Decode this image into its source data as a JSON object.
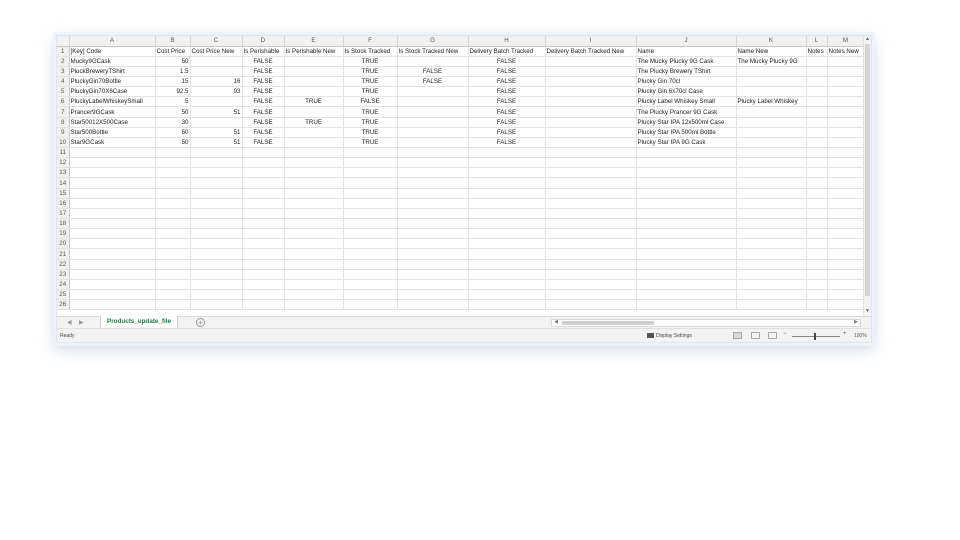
{
  "columns": [
    "A",
    "B",
    "C",
    "D",
    "E",
    "F",
    "G",
    "H",
    "I",
    "J",
    "K",
    "L",
    "M"
  ],
  "headers": [
    "[Key] Code",
    "Cost Price",
    "Cost Price New",
    "Is Perishable",
    "Is Perishable New",
    "Is Stock Tracked",
    "Is Stock Tracked New",
    "Delivery Batch Tracked",
    "Delivery Batch Tracked New",
    "Name",
    "Name New",
    "Notes",
    "Notes New"
  ],
  "rows": [
    [
      "Mucky9GCask",
      "50",
      "",
      "FALSE",
      "",
      "TRUE",
      "",
      "FALSE",
      "",
      "The Mucky Plucky 9G Cask",
      "The Mucky Plucky 9G",
      "",
      ""
    ],
    [
      "PluckBreweryTShirt",
      "1.5",
      "",
      "FALSE",
      "",
      "TRUE",
      "FALSE",
      "FALSE",
      "",
      "The Plucky Brewery TShirt",
      "",
      "",
      ""
    ],
    [
      "PluckyGin70Bottle",
      "15",
      "16",
      "FALSE",
      "",
      "TRUE",
      "FALSE",
      "FALSE",
      "",
      "Plucky Gin 70cl",
      "",
      "",
      ""
    ],
    [
      "PluckyGin70X6Case",
      "92.5",
      "93",
      "FALSE",
      "",
      "TRUE",
      "",
      "FALSE",
      "",
      "Plucky Gin 6x70cl Case",
      "",
      "",
      ""
    ],
    [
      "PluckyLabelWhiskeySmall",
      "5",
      "",
      "FALSE",
      "TRUE",
      "FALSE",
      "",
      "FALSE",
      "",
      "Plucky Label Whiskey Small",
      "Plucky Label Whiskey",
      "",
      ""
    ],
    [
      "Prancer9GCask",
      "50",
      "51",
      "FALSE",
      "",
      "TRUE",
      "",
      "FALSE",
      "",
      "The Plucky Prancer 9G Cask",
      "",
      "",
      ""
    ],
    [
      "Star50012X500Case",
      "30",
      "",
      "FALSE",
      "TRUE",
      "TRUE",
      "",
      "FALSE",
      "",
      "Plucky Star IPA 12x500ml Case",
      "",
      "",
      ""
    ],
    [
      "Star500Bottle",
      "50",
      "51",
      "FALSE",
      "",
      "TRUE",
      "",
      "FALSE",
      "",
      "Plucky Star IPA 500ml Bottle",
      "",
      "",
      ""
    ],
    [
      "Star9GCask",
      "50",
      "51",
      "FALSE",
      "",
      "TRUE",
      "",
      "FALSE",
      "",
      "Plucky Star IPA 9G Cask",
      "",
      "",
      ""
    ]
  ],
  "row_numbers": [
    "1",
    "2",
    "3",
    "4",
    "5",
    "6",
    "7",
    "8",
    "9",
    "10",
    "11",
    "12",
    "13",
    "14",
    "15",
    "16",
    "17",
    "18",
    "19",
    "20",
    "21",
    "22",
    "23",
    "24",
    "25",
    "26"
  ],
  "sheet_tab": {
    "label": "Products_update_file"
  },
  "add_sheet_label": "+",
  "status": {
    "ready": "Ready",
    "display_settings": "Display Settings",
    "zoom": "100%"
  },
  "icons": {
    "display": "display-settings-icon",
    "normal_view": "normal-view-icon",
    "page_layout": "page-layout-icon",
    "page_break": "page-break-icon"
  },
  "colors": {
    "accent": "#217346",
    "header_bg": "#f1f1f1",
    "grid": "#e3e3e3"
  }
}
